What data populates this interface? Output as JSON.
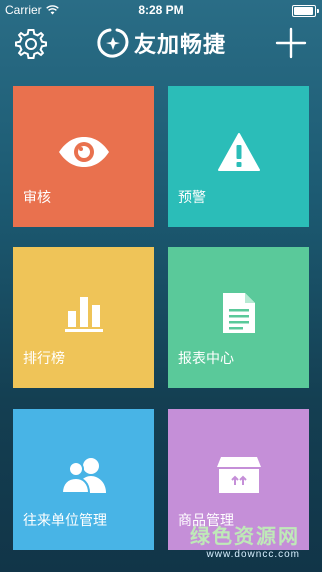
{
  "status": {
    "carrier": "Carrier",
    "time": "8:28 PM",
    "battery_level": 0.95
  },
  "header": {
    "title": "友加畅捷",
    "settings_icon": "gear-icon",
    "add_icon": "plus-icon"
  },
  "tiles": [
    {
      "label": "审核",
      "icon": "eye-icon",
      "color": "#e9714e"
    },
    {
      "label": "预警",
      "icon": "warning-icon",
      "color": "#2bbdb8"
    },
    {
      "label": "排行榜",
      "icon": "bar-chart-icon",
      "color": "#efc458"
    },
    {
      "label": "报表中心",
      "icon": "document-icon",
      "color": "#5ac99a"
    },
    {
      "label": "往来单位管理",
      "icon": "users-icon",
      "color": "#48b4e6"
    },
    {
      "label": "商品管理",
      "icon": "box-icon",
      "color": "#c58fd8"
    }
  ],
  "watermark": {
    "main": "绿色资源网",
    "sub": "www.downcc.com"
  }
}
